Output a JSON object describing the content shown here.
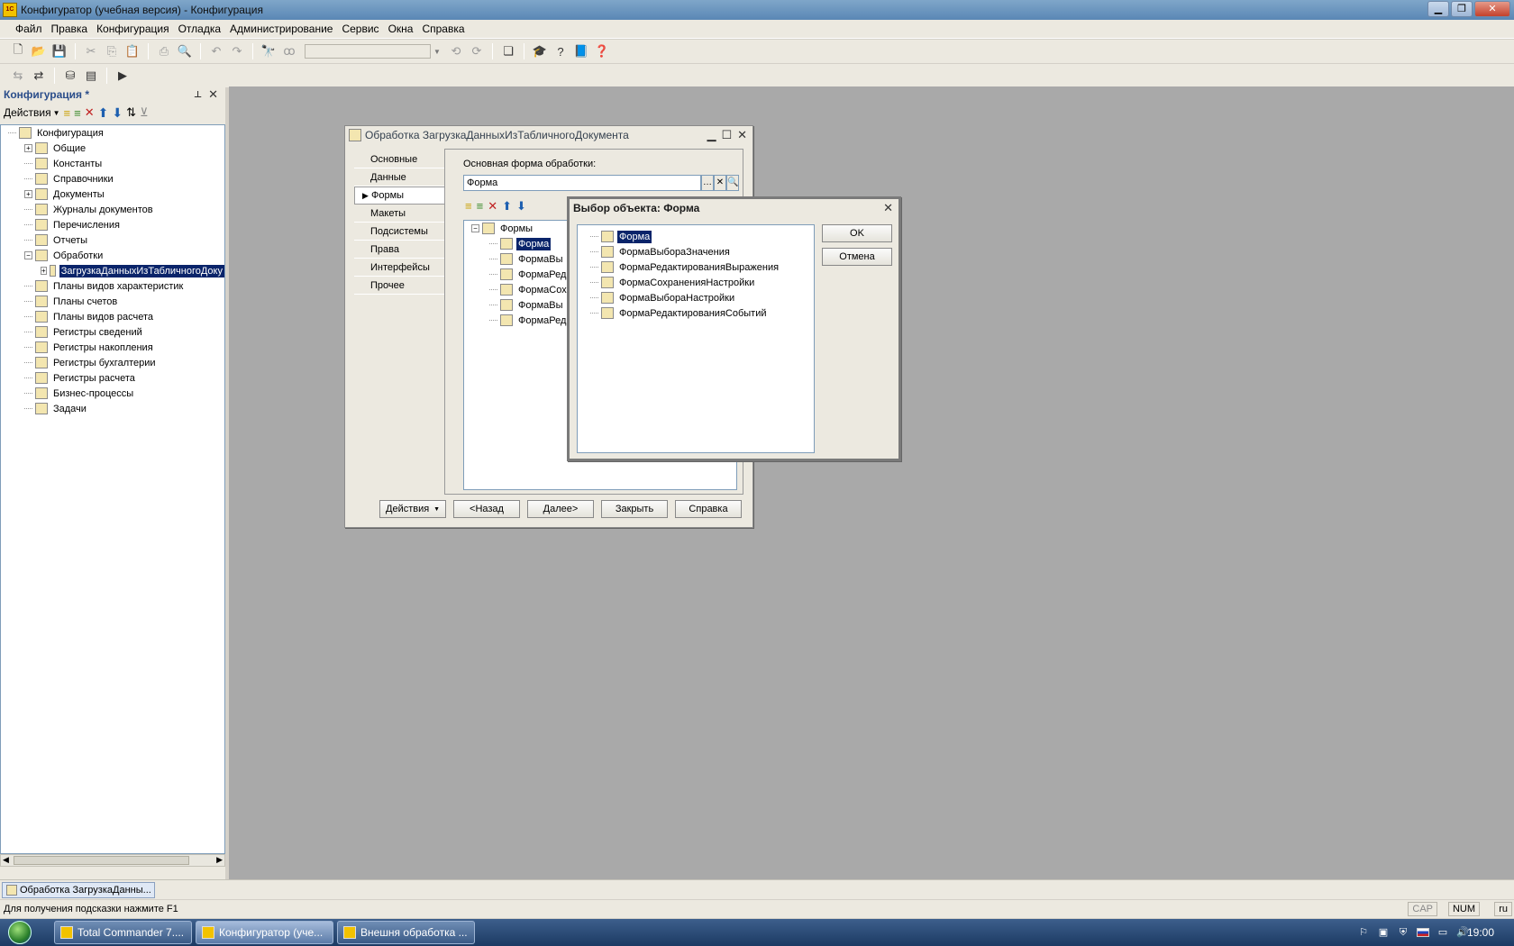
{
  "window": {
    "title": "Конфигуратор (учебная версия) - Конфигурация",
    "app_icon": "1C",
    "controls": [
      "minimize",
      "restore",
      "close"
    ]
  },
  "menu": [
    "Файл",
    "Правка",
    "Конфигурация",
    "Отладка",
    "Администрирование",
    "Сервис",
    "Окна",
    "Справка"
  ],
  "toolbar1": {
    "icons": [
      "new-icon",
      "open-icon",
      "save-icon",
      "cut-icon",
      "copy-icon",
      "paste-icon",
      "print-icon",
      "print-preview-icon",
      "undo-icon",
      "redo-icon",
      "find-icon",
      "find-next-icon",
      "search-combo",
      "find-prev-icon",
      "find-all-icon",
      "window-icon",
      "help-figure-icon",
      "context-help-icon",
      "syntax-helper-icon",
      "help-question-icon"
    ]
  },
  "toolbar2": {
    "icons": [
      "compare-icon",
      "merge-icon",
      "update-db-icon",
      "stop-icon",
      "run-debug-icon"
    ]
  },
  "left_panel": {
    "title": "Конфигурация *",
    "actions_label": "Действия",
    "tree": [
      {
        "label": "Конфигурация",
        "level": 0,
        "expand": "",
        "selected": false
      },
      {
        "label": "Общие",
        "level": 1,
        "expand": "+",
        "selected": false
      },
      {
        "label": "Константы",
        "level": 1,
        "expand": "",
        "selected": false
      },
      {
        "label": "Справочники",
        "level": 1,
        "expand": "",
        "selected": false
      },
      {
        "label": "Документы",
        "level": 1,
        "expand": "+",
        "selected": false
      },
      {
        "label": "Журналы документов",
        "level": 1,
        "expand": "",
        "selected": false
      },
      {
        "label": "Перечисления",
        "level": 1,
        "expand": "",
        "selected": false
      },
      {
        "label": "Отчеты",
        "level": 1,
        "expand": "",
        "selected": false
      },
      {
        "label": "Обработки",
        "level": 1,
        "expand": "-",
        "selected": false
      },
      {
        "label": "ЗагрузкаДанныхИзТабличногоДоку",
        "level": 2,
        "expand": "+",
        "selected": true
      },
      {
        "label": "Планы видов характеристик",
        "level": 1,
        "expand": "",
        "selected": false
      },
      {
        "label": "Планы счетов",
        "level": 1,
        "expand": "",
        "selected": false
      },
      {
        "label": "Планы видов расчета",
        "level": 1,
        "expand": "",
        "selected": false
      },
      {
        "label": "Регистры сведений",
        "level": 1,
        "expand": "",
        "selected": false
      },
      {
        "label": "Регистры накопления",
        "level": 1,
        "expand": "",
        "selected": false
      },
      {
        "label": "Регистры бухгалтерии",
        "level": 1,
        "expand": "",
        "selected": false
      },
      {
        "label": "Регистры расчета",
        "level": 1,
        "expand": "",
        "selected": false
      },
      {
        "label": "Бизнес-процессы",
        "level": 1,
        "expand": "",
        "selected": false
      },
      {
        "label": "Задачи",
        "level": 1,
        "expand": "",
        "selected": false
      }
    ]
  },
  "obr_window": {
    "title": "Обработка ЗагрузкаДанныхИзТабличногоДокумента",
    "tabs": [
      "Основные",
      "Данные",
      "Формы",
      "Макеты",
      "Подсистемы",
      "Права",
      "Интерфейсы",
      "Прочее"
    ],
    "active_tab": "Формы",
    "main_form_label": "Основная форма обработки:",
    "main_form_value": "Форма",
    "forms_tree": [
      {
        "label": "Формы",
        "level": 0,
        "expand": "-",
        "selected": false
      },
      {
        "label": "Форма",
        "level": 1,
        "expand": "",
        "selected": true
      },
      {
        "label": "ФормаВы",
        "level": 1,
        "expand": "",
        "selected": false
      },
      {
        "label": "ФормаРед",
        "level": 1,
        "expand": "",
        "selected": false
      },
      {
        "label": "ФормаСох",
        "level": 1,
        "expand": "",
        "selected": false
      },
      {
        "label": "ФормаВы",
        "level": 1,
        "expand": "",
        "selected": false
      },
      {
        "label": "ФормаРед",
        "level": 1,
        "expand": "",
        "selected": false
      }
    ],
    "buttons": {
      "actions": "Действия",
      "back": "<Назад",
      "next": "Далее>",
      "close": "Закрыть",
      "help": "Справка"
    }
  },
  "select_dialog": {
    "title": "Выбор объекта: Форма",
    "items": [
      {
        "label": "Форма",
        "selected": true
      },
      {
        "label": "ФормаВыбораЗначения",
        "selected": false
      },
      {
        "label": "ФормаРедактированияВыражения",
        "selected": false
      },
      {
        "label": "ФормаСохраненияНастройки",
        "selected": false
      },
      {
        "label": "ФормаВыбораНастройки",
        "selected": false
      },
      {
        "label": "ФормаРедактированияСобытий",
        "selected": false
      }
    ],
    "ok": "OK",
    "cancel": "Отмена"
  },
  "window_tab": "Обработка ЗагрузкаДанны...",
  "status": {
    "hint": "Для получения подсказки нажмите F1",
    "cap": "CAP",
    "num": "NUM",
    "lang": "ru"
  },
  "taskbar": {
    "tasks": [
      {
        "label": "Total Commander 7....",
        "active": false
      },
      {
        "label": "Конфигуратор (уче...",
        "active": true
      },
      {
        "label": "Внешня обработка ...",
        "active": false
      }
    ],
    "clock": "19:00"
  }
}
